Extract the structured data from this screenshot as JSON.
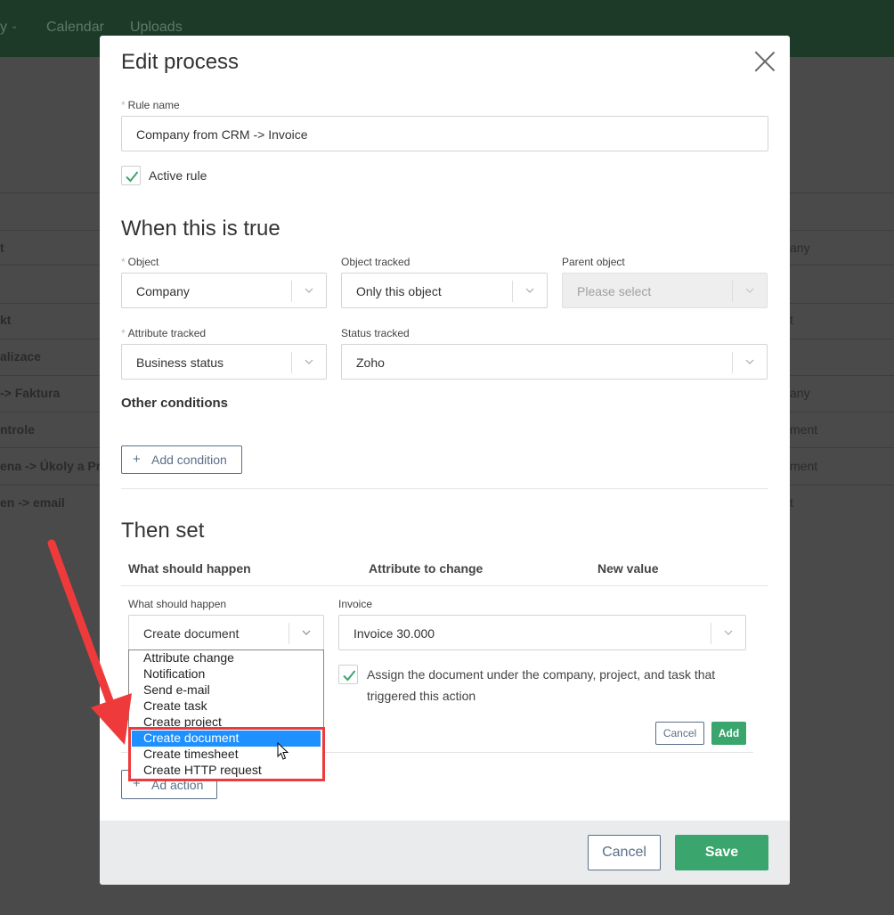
{
  "background": {
    "nav": {
      "item0": "y",
      "item1": "Calendar",
      "item2": "Uploads"
    },
    "rows": [
      "t",
      "kt",
      "alizace",
      "-> Faktura",
      "ntrole",
      "ena -> Úkoly a Pro",
      "en -> email"
    ],
    "right_col": [
      "any",
      "t",
      "any",
      "ment",
      "ment",
      "t"
    ]
  },
  "modal": {
    "title": "Edit process",
    "rule_name_label": "Rule name",
    "rule_name_value": "Company from CRM -> Invoice",
    "active_rule_label": "Active rule",
    "when_heading": "When this is true",
    "object_label": "Object",
    "object_value": "Company",
    "object_tracked_label": "Object tracked",
    "object_tracked_value": "Only this object",
    "parent_object_label": "Parent object",
    "parent_object_placeholder": "Please select",
    "attribute_tracked_label": "Attribute tracked",
    "attribute_tracked_value": "Business status",
    "status_tracked_label": "Status tracked",
    "status_tracked_value": "Zoho",
    "other_conditions_label": "Other conditions",
    "add_condition_label": "Add condition",
    "then_heading": "Then set",
    "col_what": "What should happen",
    "col_attribute": "Attribute to change",
    "col_new_value": "New value",
    "what_label": "What should happen",
    "what_value": "Create document",
    "invoice_label": "Invoice",
    "invoice_value": "Invoice 30.000",
    "assign_text_line1": "Assign the document under the company, project, and task that",
    "assign_text_line2": "triggered this action",
    "row_cancel": "Cancel",
    "row_add": "Add",
    "add_action_label": "Ad action",
    "footer_cancel": "Cancel",
    "footer_save": "Save"
  },
  "dropdown": {
    "options": [
      "Attribute change",
      "Notification",
      "Send e-mail",
      "Create task",
      "Create project",
      "Create document",
      "Create timesheet",
      "Create HTTP request"
    ],
    "selected": "Create document"
  },
  "colors": {
    "accent_green": "#3aa56d",
    "annotation_red": "#ee3a3a",
    "selection_blue": "#1e90ff"
  },
  "icons": {
    "close": "close-icon",
    "chevron": "chevron-down-icon",
    "check": "check-icon",
    "plus": "plus-icon",
    "cursor": "mouse-cursor-icon",
    "arrow": "annotation-arrow-icon"
  }
}
